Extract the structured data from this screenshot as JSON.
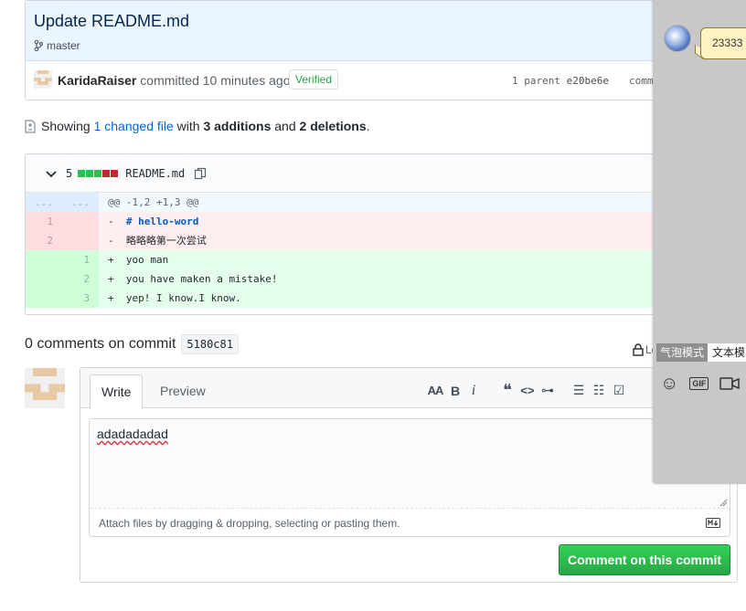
{
  "commit": {
    "title": "Update README.md",
    "branch": "master",
    "author": "KaridaRaiser",
    "action": "committed",
    "time": "10 minutes ago",
    "verified": "Verified",
    "parent_label": "1 parent",
    "parent_sha": "e20be6e",
    "commit_label": "commit"
  },
  "summary": {
    "prefix": "Showing",
    "changed": "1 changed file",
    "with": "with",
    "additions": "3 additions",
    "and": "and",
    "deletions": "2 deletions",
    "end": "."
  },
  "file": {
    "count": "5",
    "name": "README.md",
    "diffstat": [
      "#2cbe4e",
      "#2cbe4e",
      "#2cbe4e",
      "#cb2431",
      "#cb2431"
    ],
    "hunk": {
      "left": "...",
      "right": "...",
      "text": "@@ -1,2 +1,3 @@"
    },
    "lines": [
      {
        "type": "del",
        "old": "1",
        "new": "",
        "sign": "-",
        "text": "# hello-word"
      },
      {
        "type": "del",
        "old": "2",
        "new": "",
        "sign": "-",
        "text": "略略略第一次尝试"
      },
      {
        "type": "add",
        "old": "",
        "new": "1",
        "sign": "+",
        "text": "yoo man"
      },
      {
        "type": "add",
        "old": "",
        "new": "2",
        "sign": "+",
        "text": "you have maken a mistake!"
      },
      {
        "type": "add",
        "old": "",
        "new": "3",
        "sign": "+",
        "text": "yep! I know.I know."
      }
    ]
  },
  "comments": {
    "title": "0 comments on commit",
    "sha": "5180c81",
    "lock_text": "Lo"
  },
  "editor": {
    "tab_write": "Write",
    "tab_preview": "Preview",
    "toolbar": {
      "heading": "AA",
      "bold": "B",
      "italic": "i",
      "quote": "❝",
      "code": "<>",
      "link": "⊶",
      "ul": "☰",
      "ol": "☷",
      "task": "☑"
    },
    "value": "adadadadad",
    "attach_hint": "Attach files by dragging & dropping, selecting or pasting them.",
    "submit": "Comment on this commit"
  },
  "chat": {
    "bubble": "23333",
    "mode_bubble": "气泡模式",
    "mode_text": "文本模",
    "tools": {
      "emoji": "☺",
      "gif": "GIF",
      "video": "▶",
      "cut": "✂"
    }
  }
}
